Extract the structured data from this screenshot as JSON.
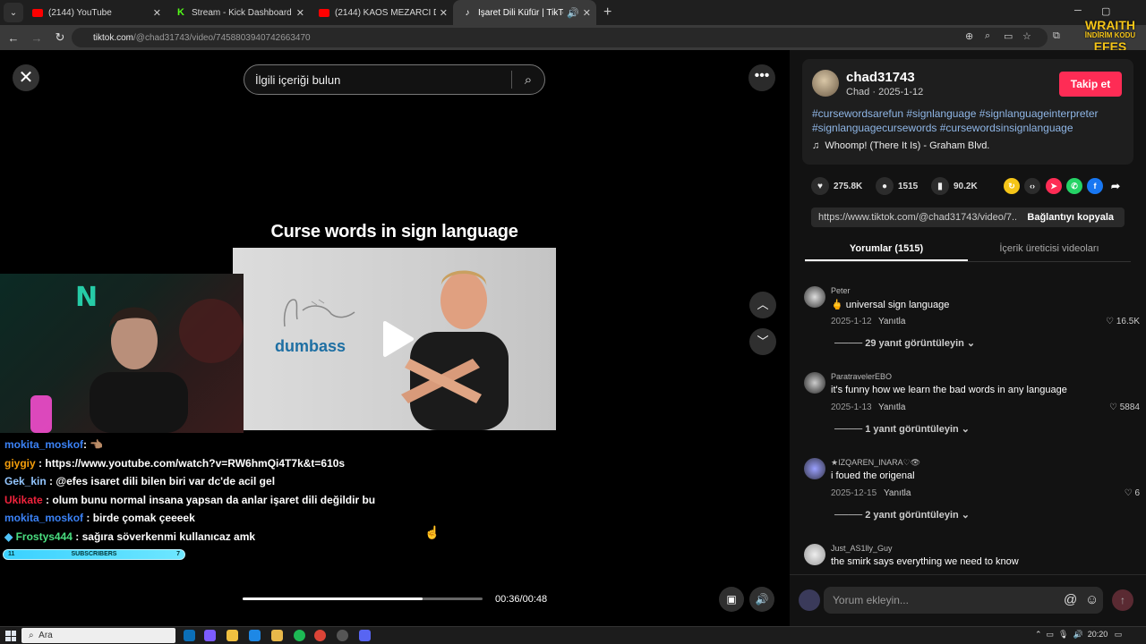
{
  "browser": {
    "tabs": [
      {
        "title": "(2144) YouTube",
        "icon": "youtube-icon"
      },
      {
        "title": "Stream - Kick Dashboard",
        "icon": "kick-icon"
      },
      {
        "title": "(2144) KAOS MEZARCI DOCH KAVGA",
        "icon": "youtube-icon"
      },
      {
        "title": "İşaret Dili Küfür | TikTok",
        "icon": "tiktok-icon"
      }
    ],
    "url_domain": "tiktok.com",
    "url_path": "/@chad31743/video/7458803940742663470"
  },
  "overlay_brand": {
    "line1": "WRAITH",
    "line2": "İNDİRİM KODU",
    "line3": "EFES"
  },
  "video": {
    "search_placeholder": "İlgili içeriği bulun",
    "caption": "Curse words in sign language",
    "on_screen_word": "dumbass",
    "time": "00:36/00:48",
    "progress": 0.75
  },
  "chat": [
    {
      "user": "mokita_moskof",
      "msg": ": 👈🏽",
      "color": "#3b82f6"
    },
    {
      "user": "giygiy",
      "msg": ": https://www.youtube.com/watch?v=RW6hmQi4T7k&t=610s",
      "color": "#f59e0b"
    },
    {
      "user": "Gek_kin",
      "msg": ": @efes isaret dili bilen biri var dc'de acil gel",
      "color": "#93c5fd"
    },
    {
      "user": "Ukikate",
      "msg": ": olum bunu normal insana yapsan da anlar işaret dili değildir bu",
      "color": "#ef233c"
    },
    {
      "user": "mokita_moskof",
      "msg": ": birde çomak çeeeek",
      "color": "#3b82f6"
    },
    {
      "user": "Frostys444",
      "msg": ": sağıra söverkenmi kullanıcaz amk",
      "color": "#4ade80"
    }
  ],
  "subs": {
    "label": "SUBSCRIBERS",
    "left": "11",
    "right": "7"
  },
  "post": {
    "username": "chad31743",
    "subline": "Chad · 2025-1-12",
    "follow_label": "Takip et",
    "hashtags": "#cursewordsarefun #signlanguage #signlanguageinterpreter #signlanguagecursewords #cursewordsinsignlanguage",
    "music": "Whoomp! (There It Is) - Graham Blvd.",
    "likes": "275.8K",
    "comments": "1515",
    "saves": "90.2K",
    "link": "https://www.tiktok.com/@chad31743/video/7...",
    "copy_label": "Bağlantıyı kopyala"
  },
  "panel_tabs": [
    "Yorumlar (1515)",
    "İçerik üreticisi videoları"
  ],
  "comments_list": [
    {
      "author": "Peter",
      "text": "🖕 universal sign language",
      "date": "2025-1-12",
      "reply": "Yanıtla",
      "likes": "16.5K",
      "view_replies": "29 yanıt görüntüleyin"
    },
    {
      "author": "ParatravelerEBO",
      "text": "it's funny how we learn the bad words in any language",
      "date": "2025-1-13",
      "reply": "Yanıtla",
      "likes": "5884",
      "view_replies": "1 yanıt görüntüleyin"
    },
    {
      "author": "★IZQAREN_INARA♡👁",
      "text": "i foued the origenal",
      "date": "2025-12-15",
      "reply": "Yanıtla",
      "likes": "6",
      "view_replies": "2 yanıt görüntüleyin"
    },
    {
      "author": "Just_AS1lly_Guy",
      "text": "the smirk says everything we need to know",
      "date": "",
      "reply": "",
      "likes": "",
      "view_replies": ""
    }
  ],
  "comment_input_placeholder": "Yorum ekleyin...",
  "taskbar": {
    "search": "Ara",
    "time": "20:20"
  }
}
